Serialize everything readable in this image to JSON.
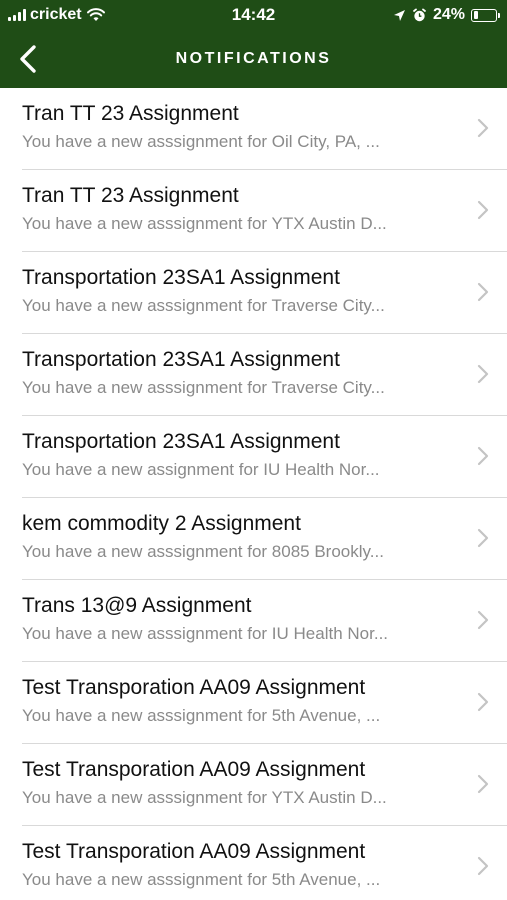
{
  "status_bar": {
    "carrier": "cricket",
    "time": "14:42",
    "battery_percent_label": "24%",
    "battery_level": 0.24,
    "icons": [
      "signal-bars-icon",
      "wifi-icon",
      "location-arrow-icon",
      "alarm-icon",
      "battery-icon"
    ]
  },
  "nav": {
    "title": "NOTIFICATIONS",
    "back_icon": "chevron-left-icon"
  },
  "colors": {
    "header_bg": "#1f4d16",
    "title_text": "#111111",
    "subtitle_text": "#8a8a8a",
    "separator": "#d9d9d9",
    "chevron": "#c4c4c4"
  },
  "notifications": [
    {
      "title": "Tran TT 23 Assignment",
      "subtitle": "You have a new asssignment for Oil City, PA, ..."
    },
    {
      "title": "Tran TT 23 Assignment",
      "subtitle": "You have a new asssignment for YTX Austin D..."
    },
    {
      "title": "Transportation 23SA1 Assignment",
      "subtitle": "You have a new asssignment for Traverse City..."
    },
    {
      "title": "Transportation 23SA1 Assignment",
      "subtitle": "You have a new asssignment for Traverse City..."
    },
    {
      "title": "Transportation 23SA1 Assignment",
      "subtitle": "You have a new assignment for IU Health Nor..."
    },
    {
      "title": "kem commodity 2 Assignment",
      "subtitle": "You have a new asssignment for 8085 Brookly..."
    },
    {
      "title": "Trans 13@9 Assignment",
      "subtitle": "You have a new asssignment for IU Health Nor..."
    },
    {
      "title": "Test Transporation AA09 Assignment",
      "subtitle": "You have a new asssignment for 5th Avenue, ..."
    },
    {
      "title": "Test Transporation AA09 Assignment",
      "subtitle": "You have a new asssignment for YTX Austin D..."
    },
    {
      "title": "Test Transporation AA09 Assignment",
      "subtitle": "You have a new asssignment for 5th Avenue, ..."
    }
  ]
}
